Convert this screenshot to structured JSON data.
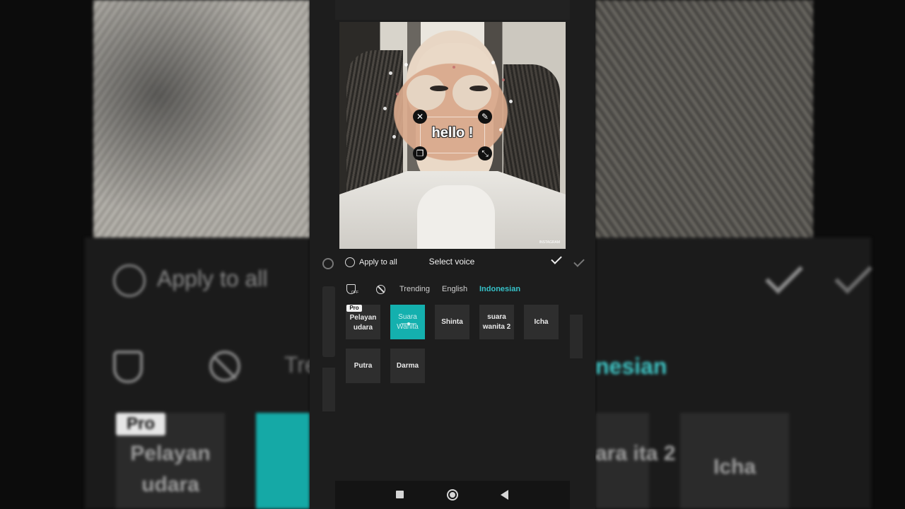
{
  "editor": {
    "overlay_text": "hello !",
    "watermark": "INSTAGRAM"
  },
  "panel": {
    "apply_to_all": "Apply to all",
    "title": "Select voice"
  },
  "tabs": [
    {
      "label": "Trending",
      "active": false
    },
    {
      "label": "English",
      "active": false
    },
    {
      "label": "Indonesian",
      "active": true
    }
  ],
  "voices": [
    {
      "label": "Pelayan udara",
      "pro": true,
      "selected": false
    },
    {
      "label": "Suara Wanita",
      "pro": false,
      "selected": true
    },
    {
      "label": "Shinta",
      "pro": false,
      "selected": false
    },
    {
      "label": "suara wanita 2",
      "pro": false,
      "selected": false
    },
    {
      "label": "Icha",
      "pro": false,
      "selected": false
    },
    {
      "label": "Putra",
      "pro": false,
      "selected": false
    },
    {
      "label": "Darma",
      "pro": false,
      "selected": false
    }
  ],
  "pro_badge": "Pro",
  "shield_off": "OFF",
  "background": {
    "apply_to_all": "Apply to all",
    "tab_fragment": "Tre",
    "tab_fragment_right": "nesian",
    "pro": "Pro",
    "tile_left": "Pelayan udara",
    "tile_right_partial": "ara ita 2",
    "tile_icha": "Icha"
  },
  "colors": {
    "accent": "#36c2c9",
    "selected_tile": "#14b0ae",
    "panel_bg": "#1d1d1d",
    "tile_bg": "#2e2e2e"
  },
  "icons": {
    "close": "close-icon",
    "edit": "pencil-icon",
    "copy": "copy-icon",
    "scale": "resize-icon",
    "confirm": "check-icon",
    "shield": "shield-off-icon",
    "none": "ban-icon",
    "home": "home-icon",
    "back": "back-icon",
    "recents": "recents-icon"
  }
}
